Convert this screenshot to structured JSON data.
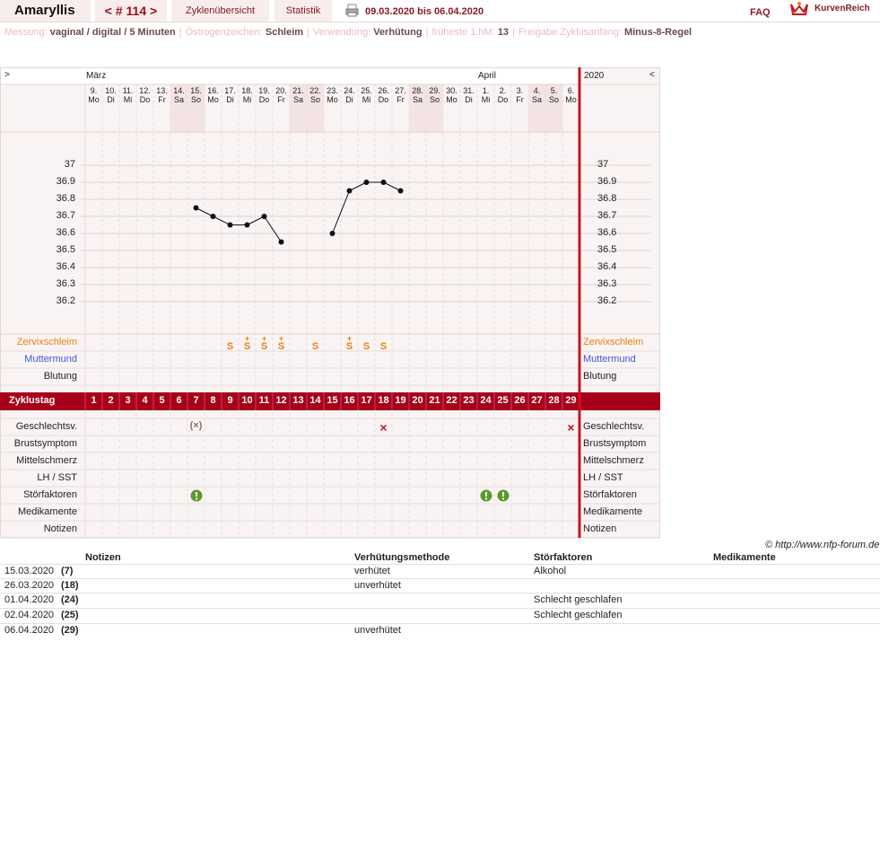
{
  "header": {
    "title": "Amaryllis",
    "cycle_nav": "< # 114 >",
    "tab_overview": "Zyklenübersicht",
    "tab_stats": "Statistik",
    "date_range": "09.03.2020 bis 06.04.2020",
    "faq": "FAQ",
    "brand": "KurvenReich"
  },
  "info": [
    {
      "key": "Messung:",
      "value": "vaginal / digital / 5 Minuten"
    },
    {
      "key": "Östrogenzeichen:",
      "value": "Schleim"
    },
    {
      "key": "Verwendung:",
      "value": "Verhütung"
    },
    {
      "key": "früheste 1.hM:",
      "value": "13"
    },
    {
      "key": "Freigabe Zyklusanfang:",
      "value": "Minus-8-Regel"
    }
  ],
  "nav": {
    "prev": ">",
    "next": "<",
    "year": "2020"
  },
  "months": [
    {
      "label": "März",
      "startIndex": 0
    },
    {
      "label": "April",
      "startIndex": 23
    }
  ],
  "days": [
    {
      "d": "9.",
      "w": "Mo"
    },
    {
      "d": "10.",
      "w": "Di"
    },
    {
      "d": "11.",
      "w": "Mi"
    },
    {
      "d": "12.",
      "w": "Do"
    },
    {
      "d": "13.",
      "w": "Fr"
    },
    {
      "d": "14.",
      "w": "Sa",
      "we": true
    },
    {
      "d": "15.",
      "w": "So",
      "we": true
    },
    {
      "d": "16.",
      "w": "Mo"
    },
    {
      "d": "17.",
      "w": "Di"
    },
    {
      "d": "18.",
      "w": "Mi"
    },
    {
      "d": "19.",
      "w": "Do"
    },
    {
      "d": "20.",
      "w": "Fr"
    },
    {
      "d": "21.",
      "w": "Sa",
      "we": true
    },
    {
      "d": "22.",
      "w": "So",
      "we": true
    },
    {
      "d": "23.",
      "w": "Mo"
    },
    {
      "d": "24.",
      "w": "Di"
    },
    {
      "d": "25.",
      "w": "Mi"
    },
    {
      "d": "26.",
      "w": "Do"
    },
    {
      "d": "27.",
      "w": "Fr"
    },
    {
      "d": "28.",
      "w": "Sa",
      "we": true
    },
    {
      "d": "29.",
      "w": "So",
      "we": true
    },
    {
      "d": "30.",
      "w": "Mo"
    },
    {
      "d": "31.",
      "w": "Di"
    },
    {
      "d": "1.",
      "w": "Mi"
    },
    {
      "d": "2.",
      "w": "Do"
    },
    {
      "d": "3.",
      "w": "Fr"
    },
    {
      "d": "4.",
      "w": "Sa",
      "we": true
    },
    {
      "d": "5.",
      "w": "So",
      "we": true
    },
    {
      "d": "6.",
      "w": "Mo"
    }
  ],
  "chart_data": {
    "type": "line",
    "ylabel": "",
    "ylim": [
      36.1,
      37.1
    ],
    "yticks": [
      "37",
      "36.9",
      "36.8",
      "36.7",
      "36.6",
      "36.5",
      "36.4",
      "36.3",
      "36.2"
    ],
    "x": [
      "15.03",
      "16.03",
      "17.03",
      "18.03",
      "19.03",
      "20.03",
      "21.03",
      "22.03",
      "23.03",
      "24.03",
      "25.03",
      "26.03",
      "27.03"
    ],
    "series": [
      {
        "values": [
          {
            "day": 7,
            "temp": 36.75
          },
          {
            "day": 8,
            "temp": 36.7
          },
          {
            "day": 9,
            "temp": 36.65
          },
          {
            "day": 10,
            "temp": 36.65
          },
          {
            "day": 11,
            "temp": 36.7
          },
          {
            "day": 12,
            "temp": 36.55
          },
          {
            "day": 15,
            "temp": 36.6
          },
          {
            "day": 16,
            "temp": 36.85
          },
          {
            "day": 17,
            "temp": 36.9
          },
          {
            "day": 18,
            "temp": 36.9
          },
          {
            "day": 19,
            "temp": 36.85
          }
        ]
      }
    ]
  },
  "rows_upper": [
    {
      "label": "Zervixschleim",
      "color": "#e8830e"
    },
    {
      "label": "Muttermund",
      "color": "#3b5bd0"
    },
    {
      "label": "Blutung",
      "color": "#222222"
    }
  ],
  "mucus": [
    {
      "day": 9,
      "sym": "S"
    },
    {
      "day": 10,
      "sym": "S+"
    },
    {
      "day": 11,
      "sym": "S+"
    },
    {
      "day": 12,
      "sym": "S+"
    },
    {
      "day": 14,
      "sym": "S"
    },
    {
      "day": 16,
      "sym": "S+"
    },
    {
      "day": 17,
      "sym": "S"
    },
    {
      "day": 18,
      "sym": "S"
    }
  ],
  "cycle_label": "Zyklustag",
  "cycle_days": [
    "1",
    "2",
    "3",
    "4",
    "5",
    "6",
    "7",
    "8",
    "9",
    "10",
    "11",
    "12",
    "13",
    "14",
    "15",
    "16",
    "17",
    "18",
    "19",
    "20",
    "21",
    "22",
    "23",
    "24",
    "25",
    "26",
    "27",
    "28",
    "29"
  ],
  "rows_lower": [
    "Geschlechtsv.",
    "Brustsymptom",
    "Mittelschmerz",
    "LH / SST",
    "Störfaktoren",
    "Medikamente",
    "Notizen"
  ],
  "intercourse": [
    {
      "day": 7,
      "sym": "(×)",
      "color": "#8a7070"
    },
    {
      "day": 18,
      "sym": "×",
      "color": "#c4161c"
    },
    {
      "day": 29,
      "sym": "×",
      "color": "#c4161c"
    }
  ],
  "disturbances": [
    7,
    24,
    25
  ],
  "colors": {
    "accent": "#c4161c",
    "cycle_bar": "#a8001a",
    "weekend": "#f3e3e5",
    "grid": "#e6d8d8",
    "mucus": "#e8830e",
    "warn": "#5a9a2a"
  },
  "copyright": "© http://www.nfp-forum.de",
  "table": {
    "headers": [
      "Notizen",
      "Verhütungsmethode",
      "Störfaktoren",
      "Medikamente"
    ],
    "rows": [
      {
        "date": "15.03.2020",
        "day": "(7)",
        "method": "verhütet",
        "disturb": "Alkohol"
      },
      {
        "date": "26.03.2020",
        "day": "(18)",
        "method": "unverhütet",
        "disturb": ""
      },
      {
        "date": "01.04.2020",
        "day": "(24)",
        "method": "",
        "disturb": "Schlecht geschlafen"
      },
      {
        "date": "02.04.2020",
        "day": "(25)",
        "method": "",
        "disturb": "Schlecht geschlafen"
      },
      {
        "date": "06.04.2020",
        "day": "(29)",
        "method": "unverhütet",
        "disturb": ""
      }
    ]
  }
}
